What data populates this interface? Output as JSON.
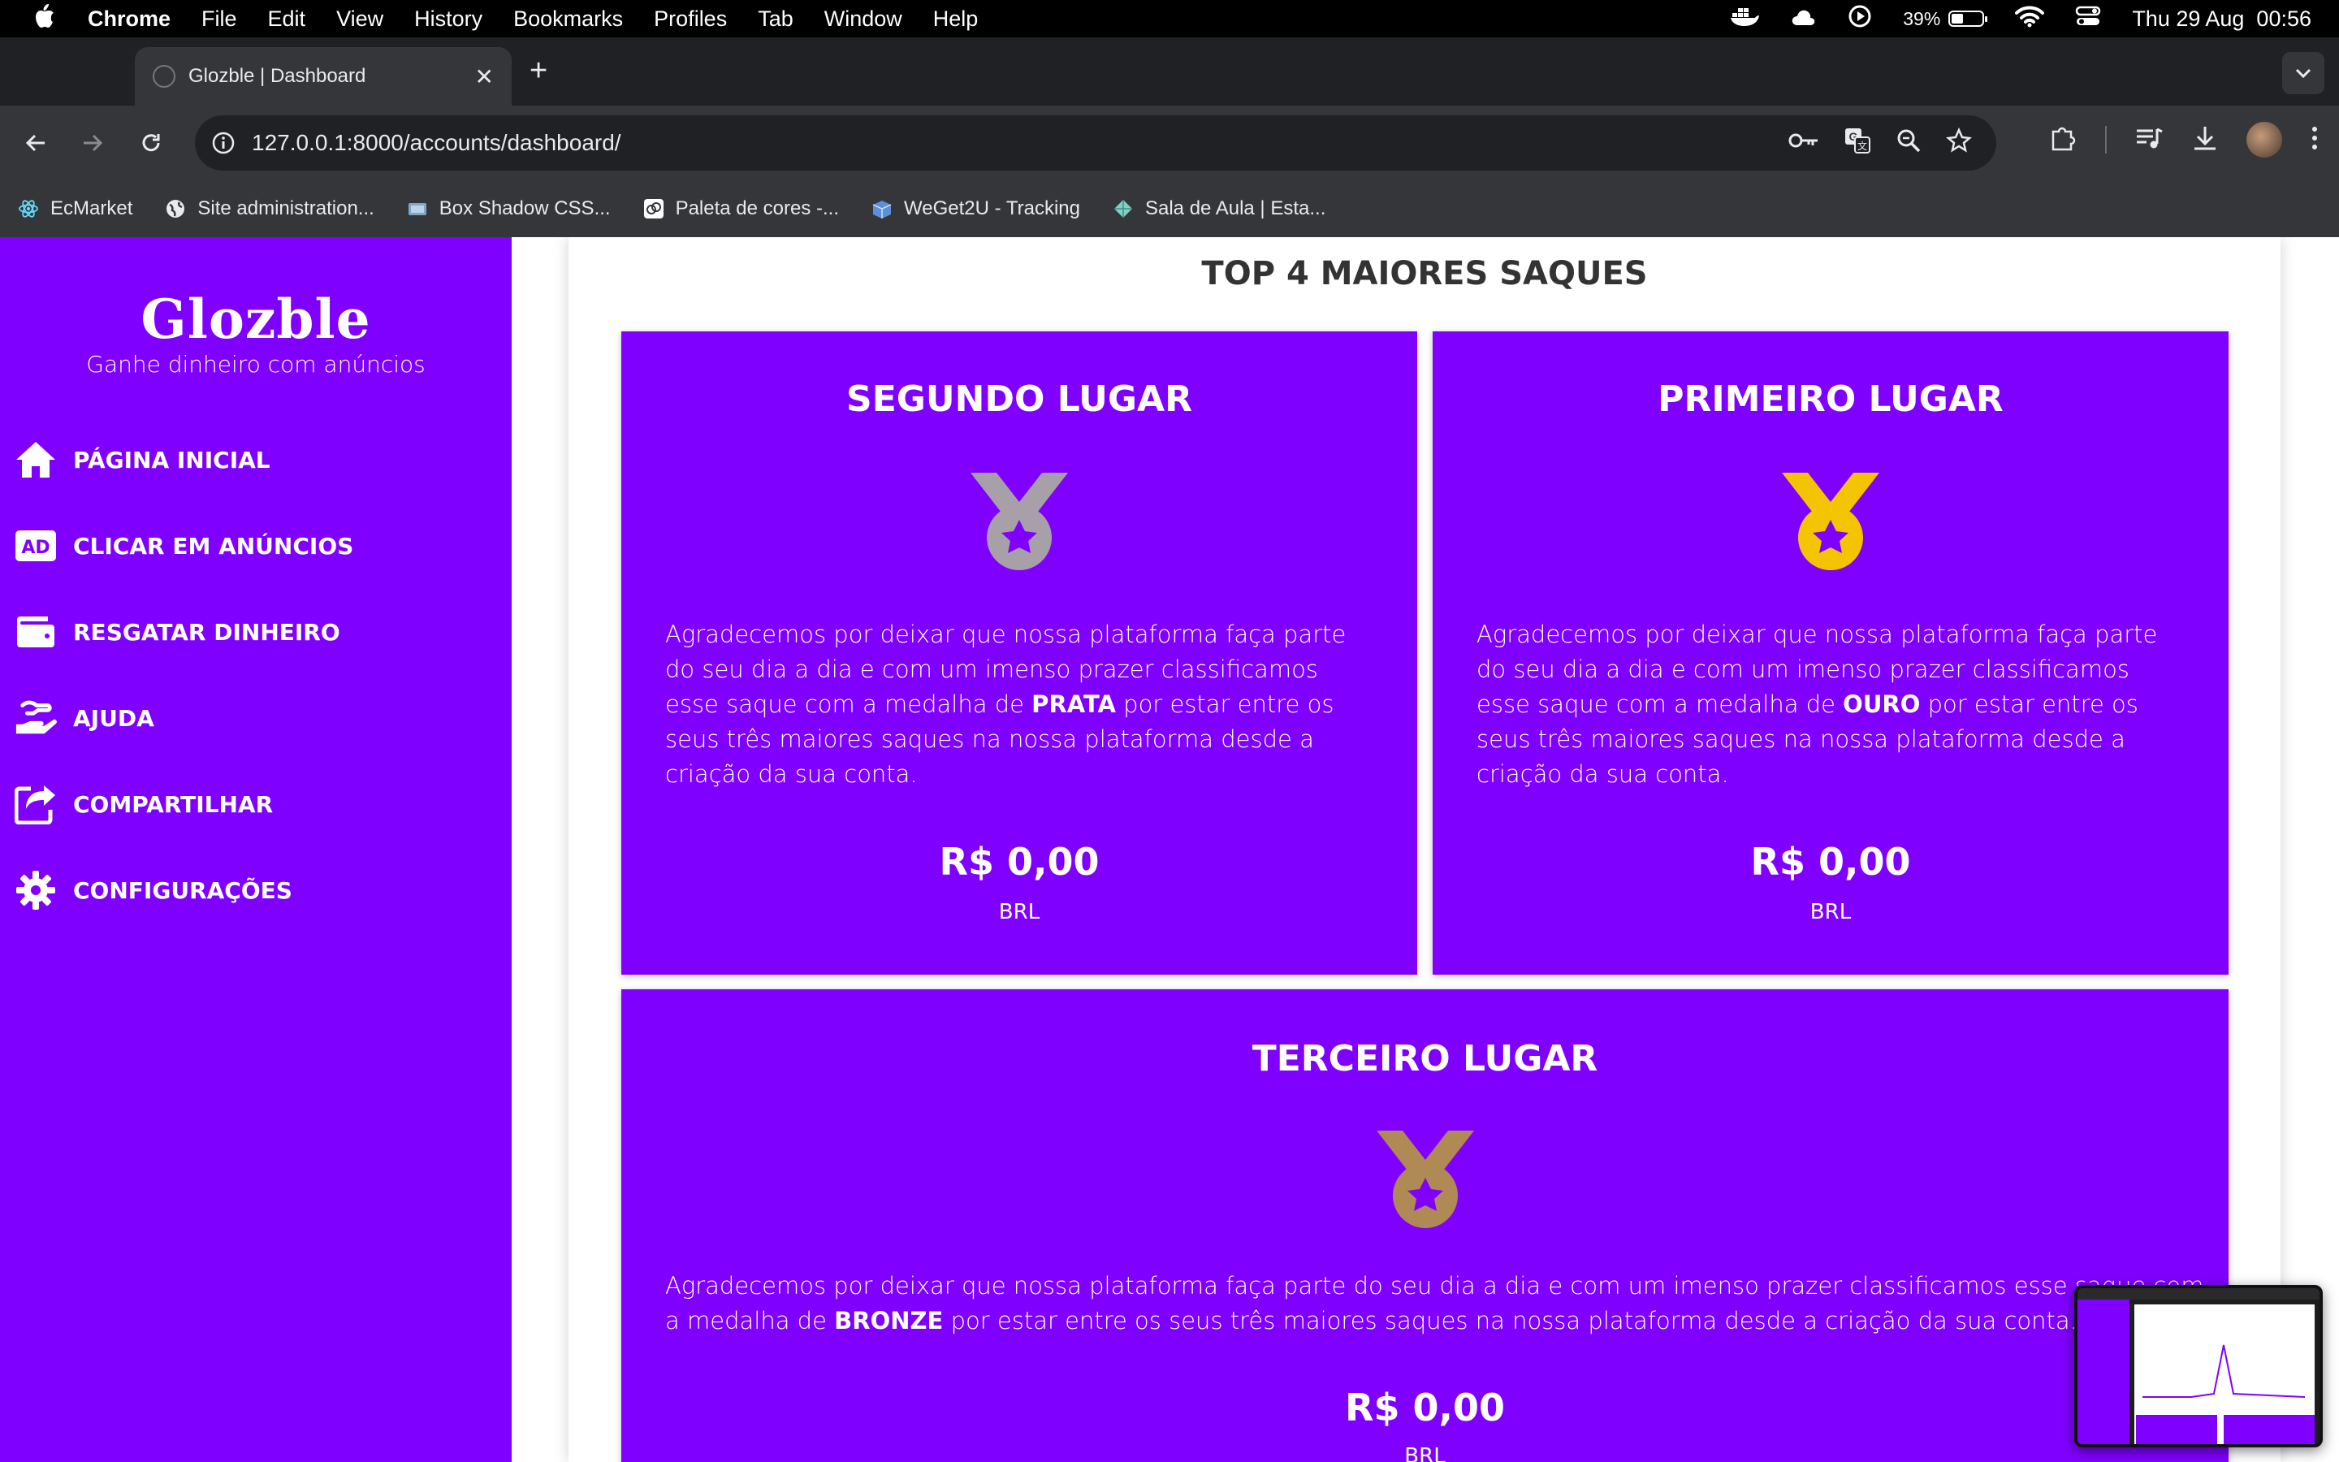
{
  "menubar": {
    "app": "Chrome",
    "menus": [
      "File",
      "Edit",
      "View",
      "History",
      "Bookmarks",
      "Profiles",
      "Tab",
      "Window",
      "Help"
    ],
    "battery_percent": "39%",
    "battery_level": 0.39,
    "datetime": "Thu 29 Aug  00:56"
  },
  "browser": {
    "tab_title": "Glozble | Dashboard",
    "url": "127.0.0.1:8000/accounts/dashboard/",
    "bookmarks": [
      {
        "label": "EcMarket",
        "icon": "react-icon"
      },
      {
        "label": "Site administration...",
        "icon": "globe-icon"
      },
      {
        "label": "Box Shadow CSS...",
        "icon": "box-shadow-icon"
      },
      {
        "label": "Paleta de cores -...",
        "icon": "palette-icon"
      },
      {
        "label": "WeGet2U - Tracking",
        "icon": "weget-icon"
      },
      {
        "label": "Sala de Aula | Esta...",
        "icon": "diamond-icon"
      }
    ]
  },
  "sidebar": {
    "brand": "Glozble",
    "tagline": "Ganhe dinheiro com anúncios",
    "items": [
      {
        "label": "PÁGINA INICIAL",
        "icon": "home-icon"
      },
      {
        "label": "CLICAR EM ANÚNCIOS",
        "icon": "ad-icon"
      },
      {
        "label": "RESGATAR DINHEIRO",
        "icon": "wallet-icon"
      },
      {
        "label": "AJUDA",
        "icon": "hand-help-icon"
      },
      {
        "label": "COMPARTILHAR",
        "icon": "share-icon"
      },
      {
        "label": "CONFIGURAÇÕES",
        "icon": "gear-icon"
      }
    ]
  },
  "main": {
    "section_title": "TOP 4 MAIORES SAQUES",
    "cards": [
      {
        "title": "SEGUNDO LUGAR",
        "medal_color": "#a8a0a8",
        "text_before": "Agradecemos por deixar que nossa plataforma faça parte do seu dia a dia e com um imenso prazer classificamos esse saque com a medalha de ",
        "medal_word": "PRATA",
        "text_after": " por estar entre os seus três maiores saques na nossa plataforma desde a criação da sua conta.",
        "amount": "R$ 0,00",
        "currency": "BRL"
      },
      {
        "title": "PRIMEIRO LUGAR",
        "medal_color": "#f5c400",
        "text_before": "Agradecemos por deixar que nossa plataforma faça parte do seu dia a dia e com um imenso prazer classificamos esse saque com a medalha de ",
        "medal_word": "OURO",
        "text_after": " por estar entre os seus três maiores saques na nossa plataforma desde a criação da sua conta.",
        "amount": "R$ 0,00",
        "currency": "BRL"
      },
      {
        "title": "TERCEIRO LUGAR",
        "medal_color": "#b08a55",
        "text_before": "Agradecemos por deixar que nossa plataforma faça parte do seu dia a dia e com um imenso prazer classificamos esse saque com a medalha de ",
        "medal_word": "BRONZE",
        "text_after": " por estar entre os seus três maiores saques na nossa plataforma desde a criação da sua conta.",
        "amount": "R$ 0,00",
        "currency": "BRL"
      }
    ]
  },
  "colors": {
    "brand_purple": "#8000ff",
    "chrome_dark": "#35363a"
  }
}
